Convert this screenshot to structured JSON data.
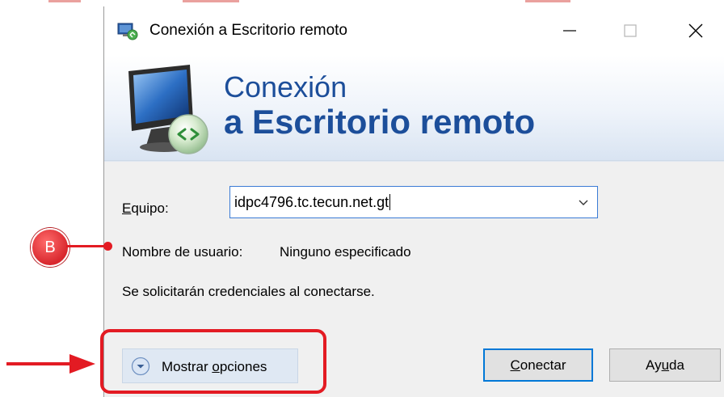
{
  "window": {
    "title": "Conexión a Escritorio remoto",
    "controls": {
      "minimize": "—",
      "maximize": "☐",
      "close": "✕"
    }
  },
  "banner": {
    "line1": "Conexión",
    "line2": "a Escritorio remoto",
    "icon": "remote-desktop-monitor-icon"
  },
  "form": {
    "computer_label": {
      "pre": "",
      "underlined": "E",
      "post": "quipo:"
    },
    "computer_value": "idpc4796.tc.tecun.net.gt",
    "username_label": "Nombre de usuario:",
    "username_value": "Ninguno especificado",
    "credentials_note": "Se solicitarán credenciales al conectarse."
  },
  "buttons": {
    "show_options": {
      "pre": "Mostrar ",
      "underlined": "o",
      "post": "pciones"
    },
    "connect": {
      "pre": "",
      "underlined": "C",
      "post": "onectar"
    },
    "help": {
      "pre": "Ay",
      "underlined": "u",
      "post": "da"
    }
  },
  "annotations": {
    "marker_label": "B",
    "accent_color": "#e31b23"
  },
  "colors": {
    "banner_text": "#1c4e9a",
    "focus_border": "#0078d7"
  }
}
